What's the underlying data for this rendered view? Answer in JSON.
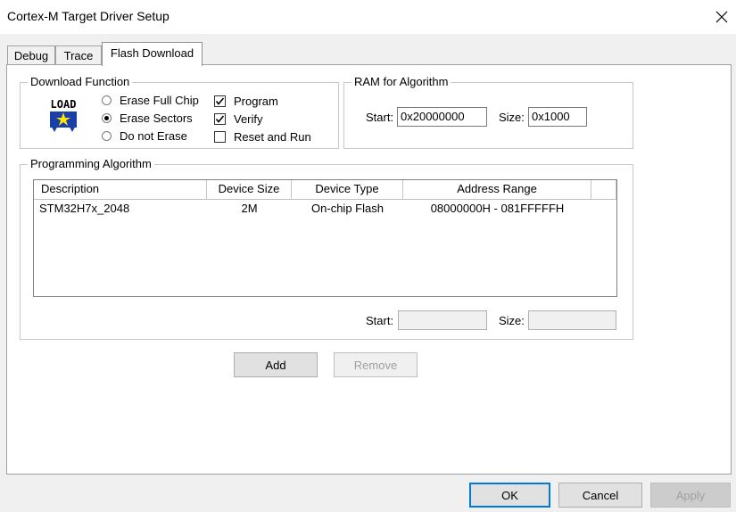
{
  "window": {
    "title": "Cortex-M Target Driver Setup",
    "close_icon": "close-icon"
  },
  "tabs": [
    {
      "label": "Debug",
      "active": false
    },
    {
      "label": "Trace",
      "active": false
    },
    {
      "label": "Flash Download",
      "active": true
    }
  ],
  "download_function": {
    "legend": "Download Function",
    "icon_label": "LOAD",
    "radios": [
      {
        "label": "Erase Full Chip",
        "selected": false
      },
      {
        "label": "Erase Sectors",
        "selected": true
      },
      {
        "label": "Do not Erase",
        "selected": false
      }
    ],
    "checks": [
      {
        "label": "Program",
        "checked": true
      },
      {
        "label": "Verify",
        "checked": true
      },
      {
        "label": "Reset and Run",
        "checked": false
      }
    ]
  },
  "ram": {
    "legend": "RAM for Algorithm",
    "start_label": "Start:",
    "start_value": "0x20000000",
    "size_label": "Size:",
    "size_value": "0x1000"
  },
  "programming_algorithm": {
    "legend": "Programming Algorithm",
    "columns": [
      "Description",
      "Device Size",
      "Device Type",
      "Address Range"
    ],
    "rows": [
      {
        "description": "STM32H7x_2048",
        "device_size": "2M",
        "device_type": "On-chip Flash",
        "address_range": "08000000H - 081FFFFFH"
      }
    ],
    "start_label": "Start:",
    "start_value": "",
    "size_label": "Size:",
    "size_value": ""
  },
  "buttons": {
    "add": "Add",
    "remove": "Remove",
    "ok": "OK",
    "cancel": "Cancel",
    "apply": "Apply"
  },
  "colors": {
    "accent": "#0078d7",
    "icon_blue": "#1a3fa8",
    "icon_yellow": "#ffe600"
  }
}
